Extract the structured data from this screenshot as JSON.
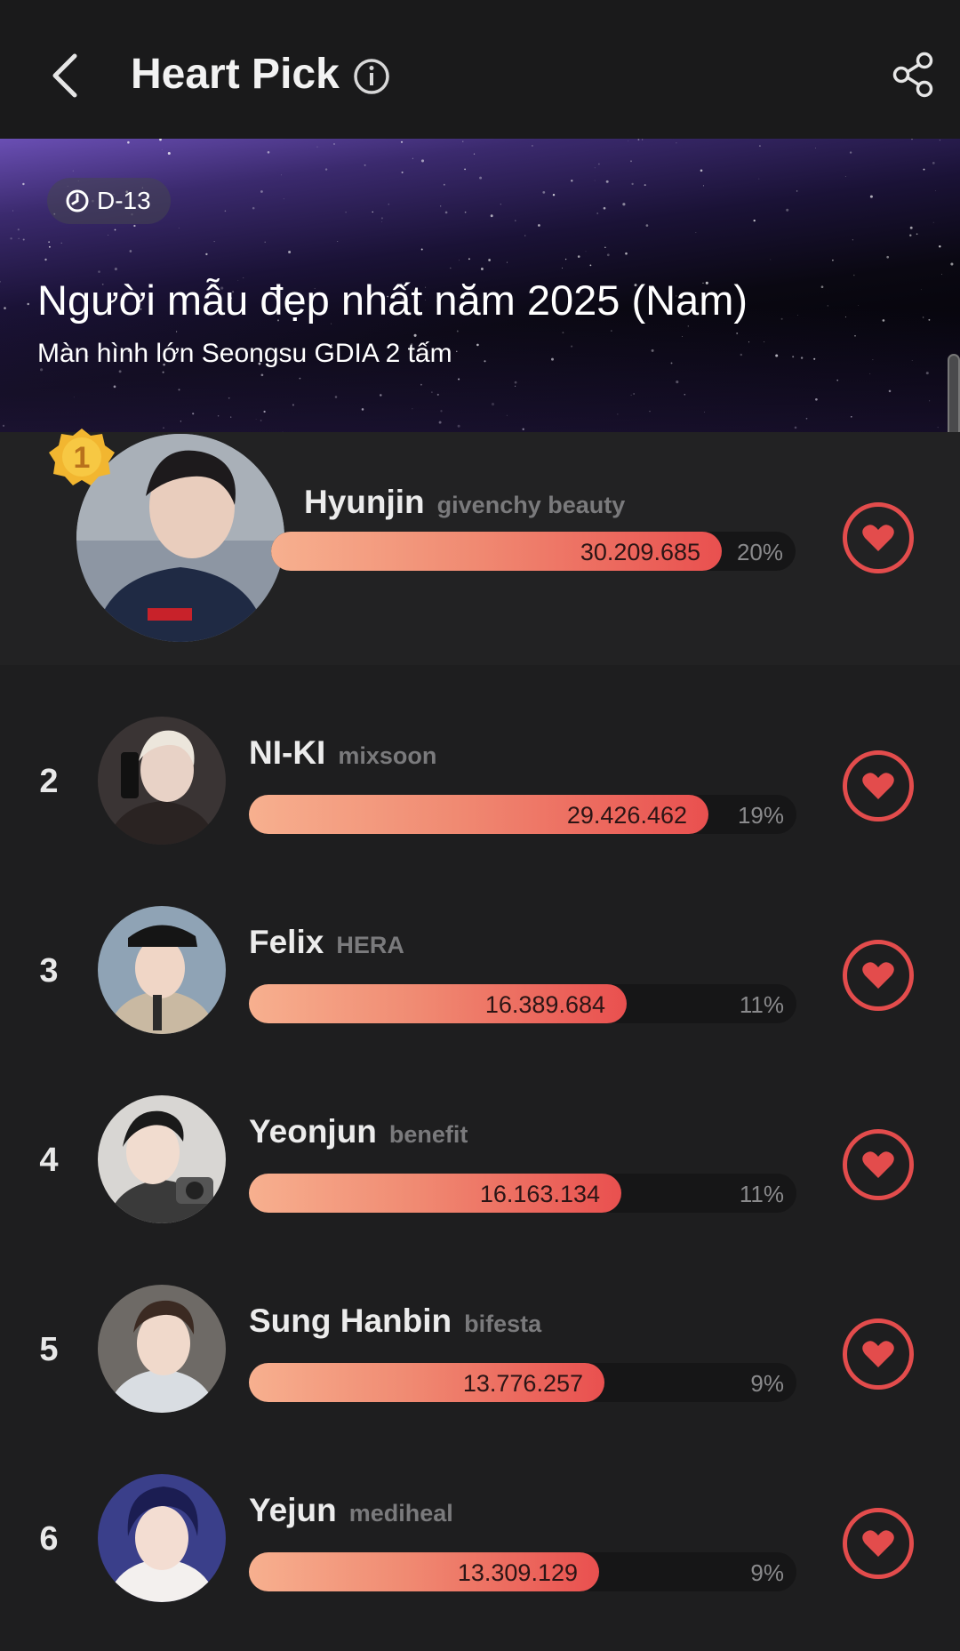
{
  "header": {
    "title": "Heart Pick",
    "back_icon": "chevron-left-icon",
    "info_icon": "info-icon",
    "share_icon": "share-icon"
  },
  "banner": {
    "dday": "D-13",
    "title": "Người mẫu đẹp nhất năm 2025 (Nam)",
    "subtitle": "Màn hình lớn Seongsu GDIA 2 tấm"
  },
  "colors": {
    "accent": "#e34c4c",
    "bar_start": "#f7b08f",
    "bar_end": "#e9504f",
    "background": "#1e1e1f"
  },
  "ranking": [
    {
      "rank": "1",
      "name": "Hyunjin",
      "brand": "givenchy beauty",
      "votes": "30.209.685",
      "percent": "20%",
      "fill": 0.86
    },
    {
      "rank": "2",
      "name": "NI-KI",
      "brand": "mixsoon",
      "votes": "29.426.462",
      "percent": "19%",
      "fill": 0.84
    },
    {
      "rank": "3",
      "name": "Felix",
      "brand": "HERA",
      "votes": "16.389.684",
      "percent": "11%",
      "fill": 0.69
    },
    {
      "rank": "4",
      "name": "Yeonjun",
      "brand": "benefit",
      "votes": "16.163.134",
      "percent": "11%",
      "fill": 0.68
    },
    {
      "rank": "5",
      "name": "Sung Hanbin",
      "brand": "bifesta",
      "votes": "13.776.257",
      "percent": "9%",
      "fill": 0.65
    },
    {
      "rank": "6",
      "name": "Yejun",
      "brand": "mediheal",
      "votes": "13.309.129",
      "percent": "9%",
      "fill": 0.64
    }
  ]
}
